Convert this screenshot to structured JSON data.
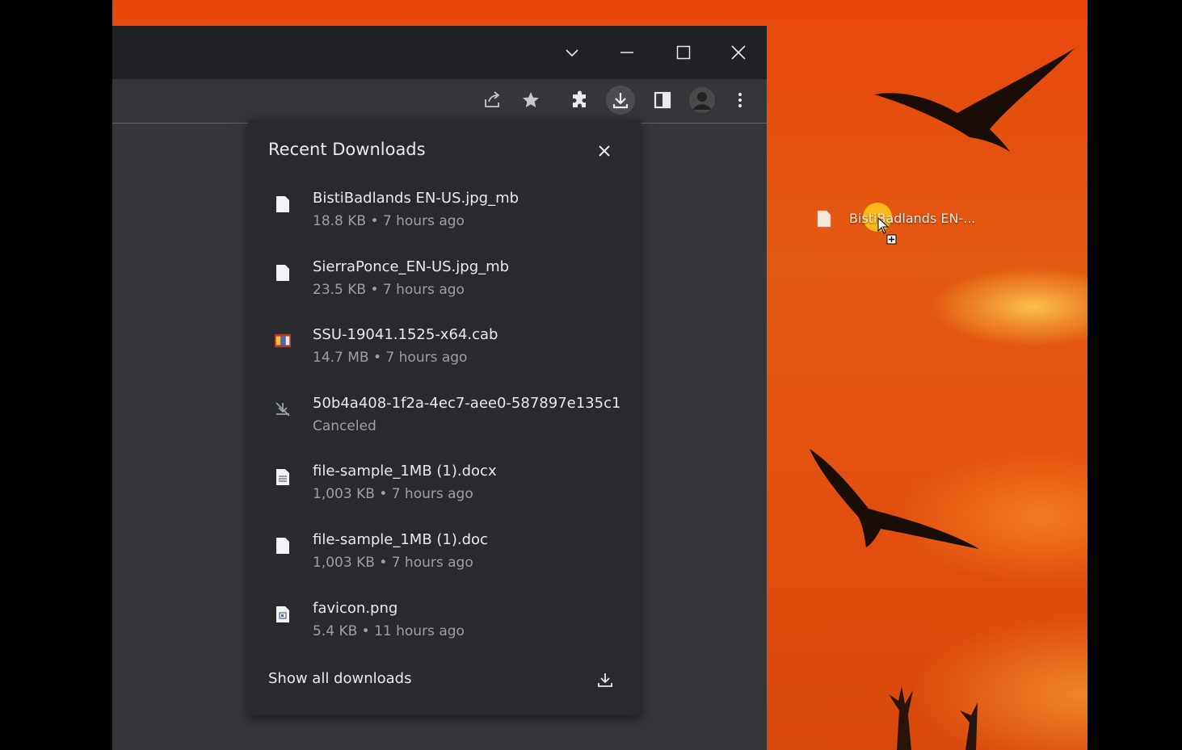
{
  "desktop": {
    "icon_label": "BistiBadlands EN-..."
  },
  "browser": {
    "titlebar_buttons": [
      "chevron-down-icon",
      "minimize-icon",
      "maximize-icon",
      "close-icon"
    ],
    "toolbar_icons": [
      "share-icon",
      "star-icon",
      "extensions-icon",
      "download-icon",
      "side-panel-icon",
      "avatar",
      "more-menu-icon"
    ]
  },
  "downloads": {
    "title": "Recent Downloads",
    "items": [
      {
        "name": "BistiBadlands EN-US.jpg_mb",
        "status": "18.8 KB • 7 hours ago",
        "icon": "file-icon"
      },
      {
        "name": "SierraPonce_EN-US.jpg_mb",
        "status": "23.5 KB • 7 hours ago",
        "icon": "file-icon"
      },
      {
        "name": "SSU-19041.1525-x64.cab",
        "status": "14.7 MB • 7 hours ago",
        "icon": "archive-icon"
      },
      {
        "name": "50b4a408-1f2a-4ec7-aee0-587897e135c1",
        "status": "Canceled",
        "icon": "canceled-download-icon"
      },
      {
        "name": "file-sample_1MB (1).docx",
        "status": "1,003 KB • 7 hours ago",
        "icon": "document-icon"
      },
      {
        "name": "file-sample_1MB (1).doc",
        "status": "1,003 KB • 7 hours ago",
        "icon": "file-icon"
      },
      {
        "name": "favicon.png",
        "status": "5.4 KB • 11 hours ago",
        "icon": "image-file-icon"
      }
    ],
    "show_all_label": "Show all downloads"
  },
  "colors": {
    "panel_bg": "#292a2d",
    "titlebar_bg": "#202124",
    "toolbar_bg": "#35363a",
    "text_primary": "#e8eaed",
    "text_secondary": "#9aa0a6",
    "desktop_orange": "#e4520f"
  }
}
